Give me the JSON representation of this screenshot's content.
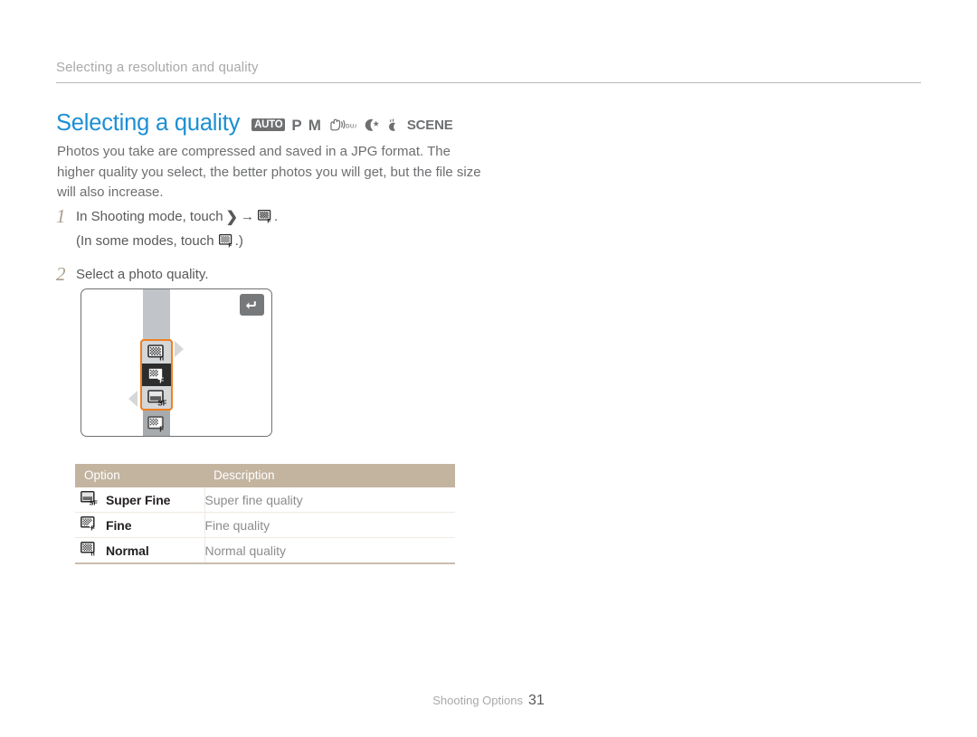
{
  "header": {
    "running_title": "Selecting a resolution and quality"
  },
  "section": {
    "title": "Selecting a quality",
    "mode_icons": [
      {
        "name": "mode-auto-icon",
        "label": "AUTO",
        "kind": "boxed-text"
      },
      {
        "name": "mode-program-icon",
        "label": "P",
        "kind": "letter"
      },
      {
        "name": "mode-manual-icon",
        "label": "M",
        "kind": "letter"
      },
      {
        "name": "mode-dual-is-icon",
        "label": "DUAL",
        "kind": "glyph"
      },
      {
        "name": "mode-night-icon",
        "label": "Night",
        "kind": "glyph"
      },
      {
        "name": "mode-beauty-shot-icon",
        "label": "Beauty Shot",
        "kind": "glyph"
      },
      {
        "name": "mode-scene-icon",
        "label": "SCENE",
        "kind": "text"
      }
    ]
  },
  "intro": {
    "paragraph": "Photos you take are compressed and saved in a JPG format. The higher quality you select, the better photos you will get, but the file size will also increase."
  },
  "steps": [
    {
      "number": "1",
      "text_before": "In Shooting mode, touch",
      "chevron": "❯",
      "arrow": "→",
      "icon_name": "quality-fine-icon",
      "text_after": ".",
      "sub_before": "(In some modes, touch",
      "sub_icon_name": "quality-fine-icon",
      "sub_after": ".)"
    },
    {
      "number": "2",
      "text_before": "Select a photo quality.",
      "chevron": "",
      "arrow": "",
      "icon_name": "",
      "text_after": "",
      "sub_before": "",
      "sub_icon_name": "",
      "sub_after": ""
    }
  ],
  "camera_screen": {
    "back_button_name": "back-button",
    "selected_options": [
      "Normal",
      "Fine",
      "Super Fine"
    ],
    "partial_option_below": "Fine"
  },
  "table": {
    "columns": [
      "Option",
      "Description"
    ],
    "rows": [
      {
        "icon": "quality-super-fine-icon",
        "option": "Super Fine",
        "description": "Super fine quality"
      },
      {
        "icon": "quality-fine-icon",
        "option": "Fine",
        "description": "Fine quality"
      },
      {
        "icon": "quality-normal-icon",
        "option": "Normal",
        "description": "Normal quality"
      }
    ]
  },
  "footer": {
    "label": "Shooting Options",
    "page_number": "31"
  },
  "colors": {
    "title_blue": "#1c8fd4",
    "table_header_tan": "#c3b4a0",
    "selection_orange": "#f08020",
    "body_grey": "#6d6e70",
    "step_number_tan": "#a99d8d"
  }
}
